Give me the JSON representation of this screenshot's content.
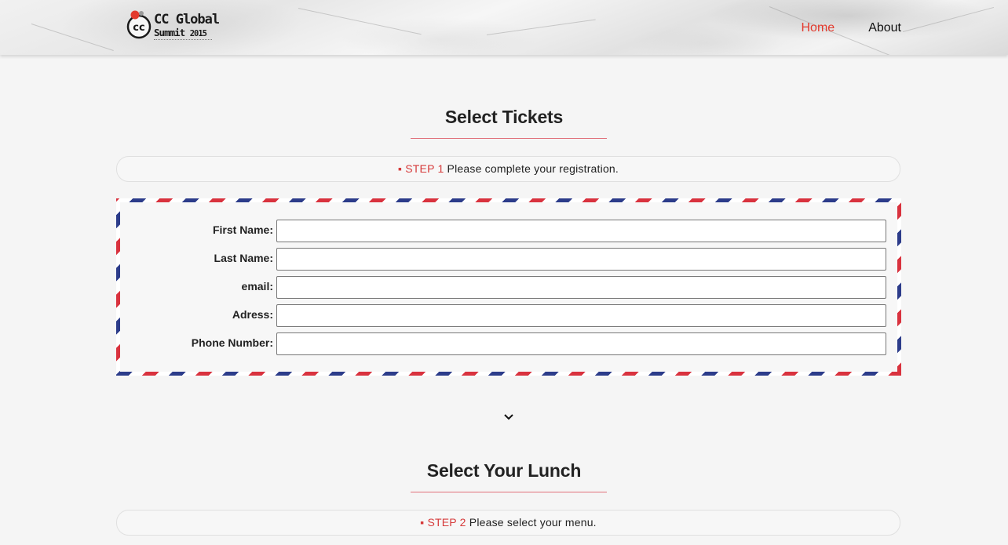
{
  "header": {
    "logo": {
      "line1": "CC Global",
      "line2": "Summit",
      "year": "2015",
      "mark": "cc"
    },
    "nav": [
      {
        "label": "Home",
        "active": true
      },
      {
        "label": "About",
        "active": false
      }
    ],
    "accent_color": "#e33a2d"
  },
  "step1": {
    "title": "Select Tickets",
    "bullet": "▪",
    "step_label": "STEP 1",
    "step_text": "Please complete your registration."
  },
  "form": {
    "fields": [
      {
        "label": "First Name:",
        "value": ""
      },
      {
        "label": "Last Name:",
        "value": ""
      },
      {
        "label": "email:",
        "value": ""
      },
      {
        "label": "Adress:",
        "value": ""
      },
      {
        "label": "Phone Number:",
        "value": ""
      }
    ],
    "border_colors": [
      "#d9323e",
      "#ffffff",
      "#2c3c8a"
    ]
  },
  "next_indicator": {
    "icon": "chevron-down-icon"
  },
  "step2": {
    "title": "Select Your Lunch",
    "bullet": "▪",
    "step_label": "STEP 2",
    "step_text": "Please select your menu."
  }
}
